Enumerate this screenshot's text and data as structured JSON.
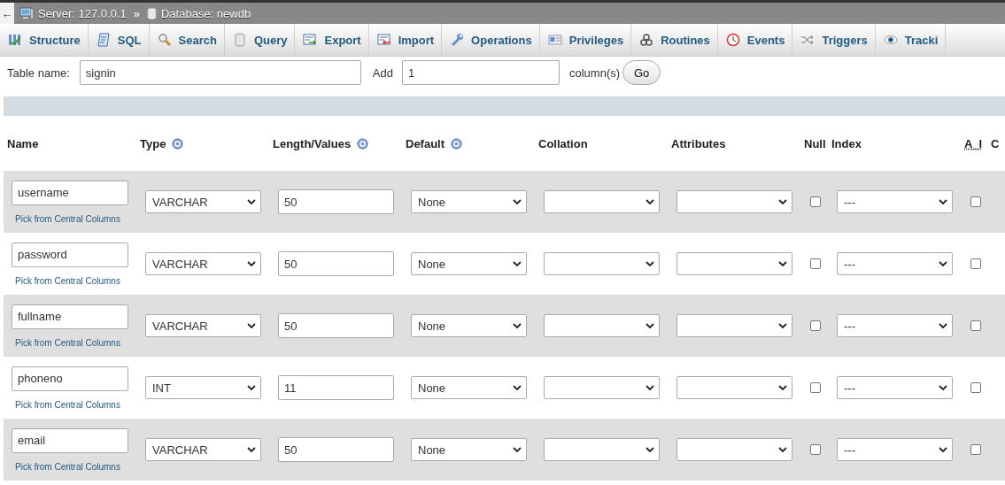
{
  "topbar": {
    "back": "←",
    "server": "Server: 127.0.0.1",
    "separator": "»",
    "database": "Database: newdb"
  },
  "tabs": [
    {
      "label": "Structure",
      "kind": "structure",
      "selected": false
    },
    {
      "label": "SQL",
      "kind": "sql",
      "selected": false
    },
    {
      "label": "Search",
      "kind": "search",
      "selected": false
    },
    {
      "label": "Query",
      "kind": "query",
      "selected": false
    },
    {
      "label": "Export",
      "kind": "export",
      "selected": false
    },
    {
      "label": "Import",
      "kind": "import",
      "selected": false
    },
    {
      "label": "Operations",
      "kind": "operations",
      "selected": false
    },
    {
      "label": "Privileges",
      "kind": "privileges",
      "selected": false
    },
    {
      "label": "Routines",
      "kind": "routines",
      "selected": false
    },
    {
      "label": "Events",
      "kind": "events",
      "selected": false
    },
    {
      "label": "Triggers",
      "kind": "triggers",
      "selected": false
    },
    {
      "label": "Tracki",
      "kind": "tracking",
      "selected": false
    }
  ],
  "form": {
    "table_name_label": "Table name:",
    "table_name": "signin",
    "add_label": "Add",
    "add_count": "1",
    "columns_label": "column(s)",
    "go": "Go"
  },
  "table": {
    "columns": [
      {
        "label": "Name",
        "help": false
      },
      {
        "label": "Type",
        "help": true
      },
      {
        "label": "Length/Values",
        "help": true
      },
      {
        "label": "Default",
        "help": true
      },
      {
        "label": "Collation",
        "help": false
      },
      {
        "label": "Attributes",
        "help": false
      },
      {
        "label": "Null",
        "help": false
      },
      {
        "label": "Index",
        "help": false
      },
      {
        "label": "A_I",
        "help": false
      },
      {
        "label": "C",
        "help": false
      }
    ],
    "rows": [
      {
        "name": "username",
        "pick": "Pick from Central Columns",
        "type": "VARCHAR",
        "length": "50",
        "default": "None",
        "null": false,
        "index": "---",
        "ai": false
      },
      {
        "name": "password",
        "pick": "Pick from Central Columns",
        "type": "VARCHAR",
        "length": "50",
        "default": "None",
        "null": false,
        "index": "---",
        "ai": false
      },
      {
        "name": "fullname",
        "pick": "Pick from Central Columns",
        "type": "VARCHAR",
        "length": "50",
        "default": "None",
        "null": false,
        "index": "---",
        "ai": false
      },
      {
        "name": "phoneno",
        "pick": "Pick from Central Columns",
        "type": "INT",
        "length": "11",
        "default": "None",
        "null": false,
        "index": "---",
        "ai": false
      },
      {
        "name": "email",
        "pick": "Pick from Central Columns",
        "type": "VARCHAR",
        "length": "50",
        "default": "None",
        "null": false,
        "index": "---",
        "ai": false
      }
    ]
  }
}
